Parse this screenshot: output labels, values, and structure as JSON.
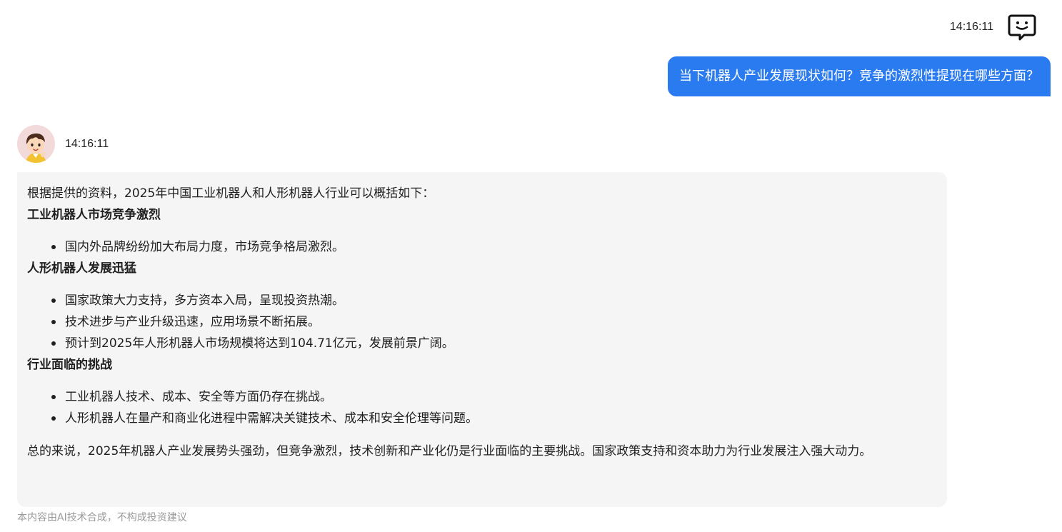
{
  "user_message": {
    "timestamp": "14:16:11",
    "avatar_icon": "chat-bubble-smile-icon",
    "text": "当下机器人产业发展现状如何？竞争的激烈性提现在哪些方面？",
    "bubble_color": "#2b7bf0"
  },
  "bot_message": {
    "timestamp": "14:16:11",
    "avatar_icon": "cartoon-boy-avatar",
    "intro": "根据提供的资料，2025年中国工业机器人和人形机器人行业可以概括如下：",
    "sections": [
      {
        "heading": "工业机器人市场竞争激烈",
        "bullets": [
          "国内外品牌纷纷加大布局力度，市场竞争格局激烈。"
        ]
      },
      {
        "heading": "人形机器人发展迅猛",
        "bullets": [
          "国家政策大力支持，多方资本入局，呈现投资热潮。",
          "技术进步与产业升级迅速，应用场景不断拓展。",
          "预计到2025年人形机器人市场规模将达到104.71亿元，发展前景广阔。"
        ]
      },
      {
        "heading": "行业面临的挑战",
        "bullets": [
          "工业机器人技术、成本、安全等方面仍存在挑战。",
          "人形机器人在量产和商业化进程中需解决关键技术、成本和安全伦理等问题。"
        ]
      }
    ],
    "summary": "总的来说，2025年机器人产业发展势头强劲，但竞争激烈，技术创新和产业化仍是行业面临的主要挑战。国家政策支持和资本助力为行业发展注入强大动力。",
    "bubble_color": "#f5f5f5"
  },
  "disclaimer": "本内容由AI技术合成，不构成投资建议"
}
